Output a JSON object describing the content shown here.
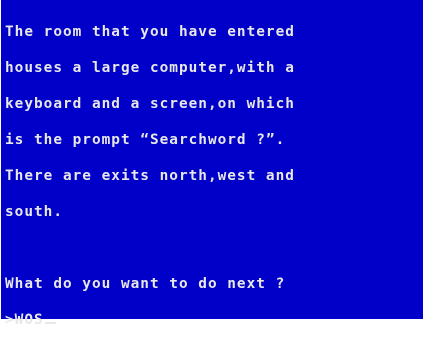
{
  "game": {
    "description_lines": [
      "The room that you have entered",
      "houses a large computer,with a",
      "keyboard and a screen,on which",
      "is the prompt “Searchword ?”.",
      "There are exits north,west and",
      "south."
    ],
    "prompt": "What do you want to do next ?",
    "input_prefix": ">",
    "input_value": "WOS"
  },
  "colors": {
    "background": "#0000c8",
    "text": "#e8e8e8"
  }
}
